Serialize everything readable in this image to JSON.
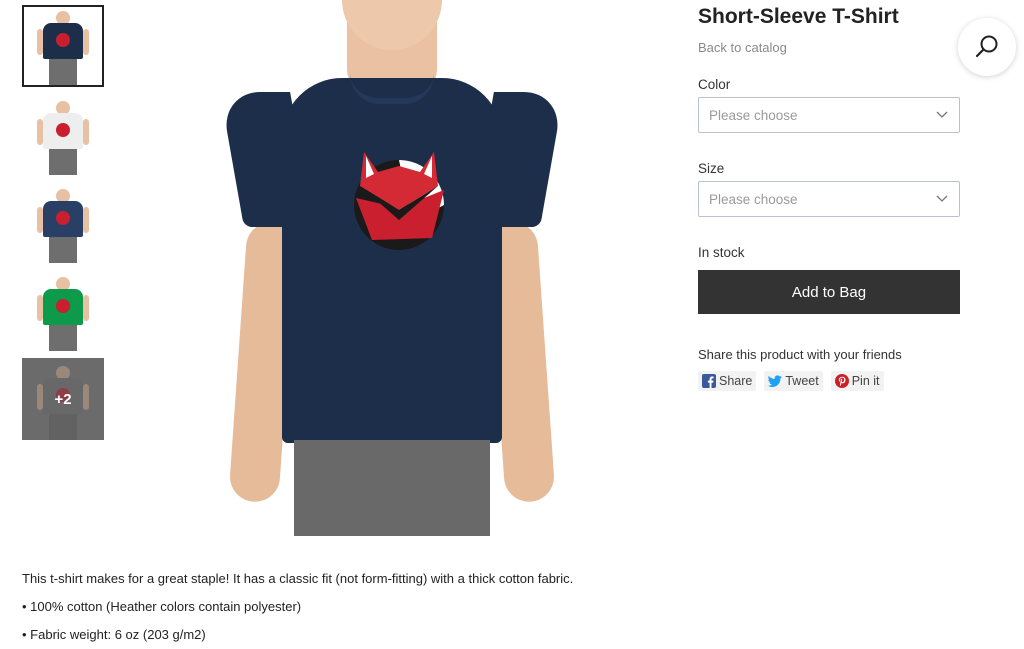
{
  "product": {
    "title": "Short-Sleeve T-Shirt",
    "back_link": "Back to catalog",
    "color_label": "Color",
    "color_placeholder": "Please choose",
    "size_label": "Size",
    "size_placeholder": "Please choose",
    "stock_status": "In stock",
    "add_to_bag": "Add to Bag"
  },
  "thumbnails": [
    {
      "shirt_color": "#1c2e4a",
      "selected": true
    },
    {
      "shirt_color": "#eeeeee",
      "selected": false
    },
    {
      "shirt_color": "#2a3f66",
      "selected": false
    },
    {
      "shirt_color": "#0d9a4a",
      "selected": false
    },
    {
      "shirt_color": "#7a7a7a",
      "overlay_text": "+2"
    }
  ],
  "share": {
    "title": "Share this product with your friends",
    "buttons": [
      {
        "label": "Share",
        "icon": "facebook-icon",
        "color": "#3b5998"
      },
      {
        "label": "Tweet",
        "icon": "twitter-icon",
        "color": "#1da1f2"
      },
      {
        "label": "Pin it",
        "icon": "pinterest-icon",
        "color": "#cb2027"
      }
    ]
  },
  "description": {
    "intro": "This t-shirt makes for a great staple! It has a classic fit (not form-fitting) with a thick cotton fabric.",
    "bullets": [
      "• 100% cotton (Heather colors contain polyester)",
      "• Fabric weight: 6 oz (203 g/m2)"
    ]
  },
  "icons": {
    "search": "search-icon",
    "chevron": "chevron-down-icon"
  },
  "colors": {
    "button_bg": "#333333",
    "brand_red": "#c91f2e"
  }
}
